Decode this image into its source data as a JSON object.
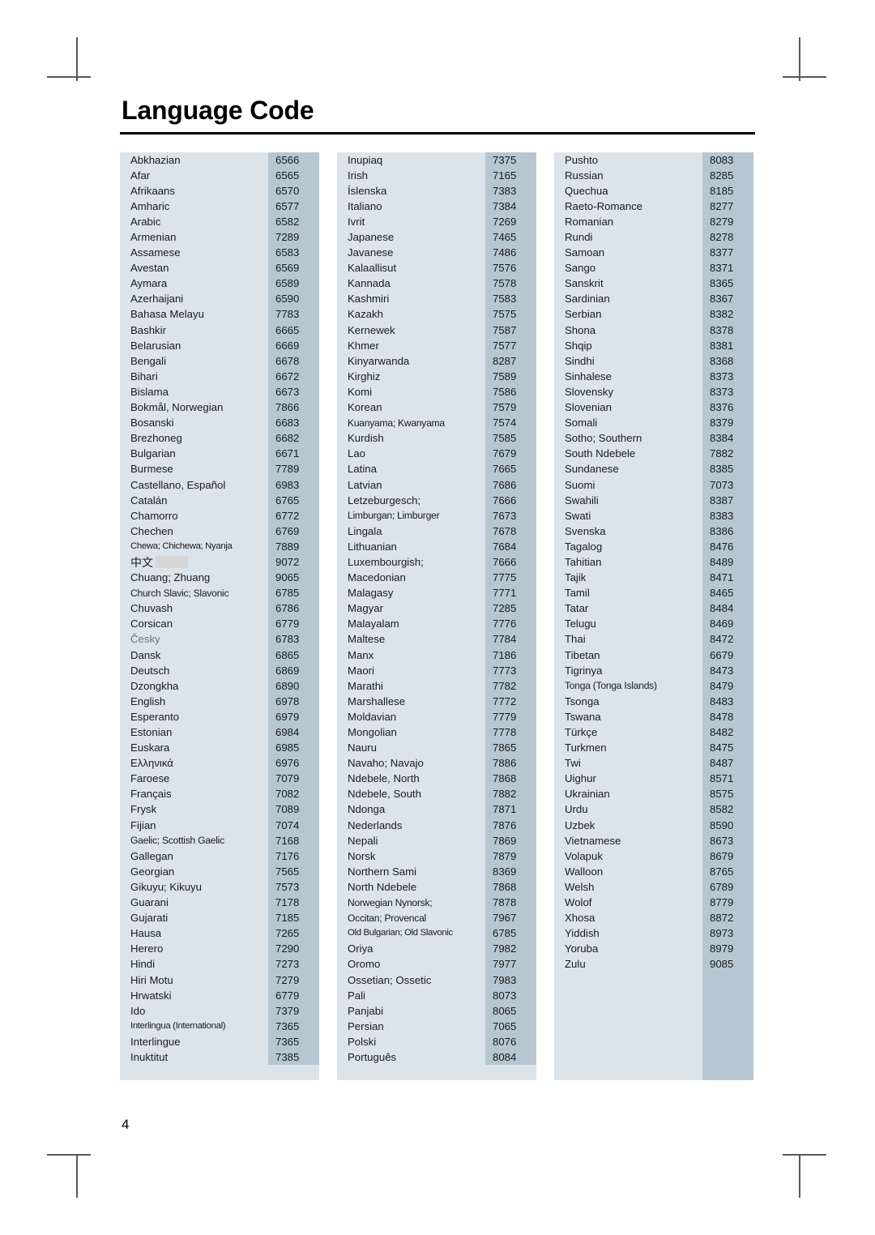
{
  "document": {
    "title": "Language Code",
    "page_number": "4"
  },
  "colors": {
    "name_band": "#dbe4ea",
    "code_band": "#b6c7d2",
    "rule": "#000000",
    "crop_mark": "#58595b",
    "redaction": "#d6d6d6"
  },
  "columns": [
    {
      "id": "column-1",
      "rows": [
        {
          "name": "Abkhazian",
          "code": "6566"
        },
        {
          "name": "Afar",
          "code": "6565"
        },
        {
          "name": "Afrikaans",
          "code": "6570"
        },
        {
          "name": "Amharic",
          "code": "6577"
        },
        {
          "name": "Arabic",
          "code": "6582"
        },
        {
          "name": "Armenian",
          "code": "7289"
        },
        {
          "name": "Assamese",
          "code": "6583"
        },
        {
          "name": "Avestan",
          "code": "6569"
        },
        {
          "name": "Aymara",
          "code": "6589"
        },
        {
          "name": "Azerhaijani",
          "code": "6590"
        },
        {
          "name": "Bahasa Melayu",
          "code": "7783"
        },
        {
          "name": "Bashkir",
          "code": "6665"
        },
        {
          "name": "Belarusian",
          "code": "6669"
        },
        {
          "name": "Bengali",
          "code": "6678"
        },
        {
          "name": "Bihari",
          "code": "6672"
        },
        {
          "name": "Bislama",
          "code": "6673"
        },
        {
          "name": "Bokmål, Norwegian",
          "code": "7866"
        },
        {
          "name": "Bosanski",
          "code": "6683"
        },
        {
          "name": "Brezhoneg",
          "code": "6682"
        },
        {
          "name": "Bulgarian",
          "code": "6671"
        },
        {
          "name": "Burmese",
          "code": "7789"
        },
        {
          "name": "Castellano, Español",
          "code": "6983"
        },
        {
          "name": "Catalán",
          "code": "6765"
        },
        {
          "name": "Chamorro",
          "code": "6772"
        },
        {
          "name": "Chechen",
          "code": "6769"
        },
        {
          "name": "Chewa; Chichewa; Nyanja",
          "code": "7889",
          "fit": "tighter"
        },
        {
          "name": "中文",
          "code": "9072",
          "style": "cjk-redacted"
        },
        {
          "name": "Chuang; Zhuang",
          "code": "9065"
        },
        {
          "name": "Church Slavic; Slavonic",
          "code": "6785",
          "fit": "tight"
        },
        {
          "name": "Chuvash",
          "code": "6786"
        },
        {
          "name": "Corsican",
          "code": "6779"
        },
        {
          "name": "Česky",
          "code": "6783",
          "style": "greyed"
        },
        {
          "name": "Dansk",
          "code": "6865"
        },
        {
          "name": "Deutsch",
          "code": "6869"
        },
        {
          "name": "Dzongkha",
          "code": "6890"
        },
        {
          "name": "English",
          "code": "6978"
        },
        {
          "name": "Esperanto",
          "code": "6979"
        },
        {
          "name": "Estonian",
          "code": "6984"
        },
        {
          "name": "Euskara",
          "code": "6985"
        },
        {
          "name": "Ελληνικά",
          "code": "6976"
        },
        {
          "name": "Faroese",
          "code": "7079"
        },
        {
          "name": "Français",
          "code": "7082"
        },
        {
          "name": "Frysk",
          "code": "7089"
        },
        {
          "name": "Fijian",
          "code": "7074"
        },
        {
          "name": "Gaelic; Scottish Gaelic",
          "code": "7168",
          "fit": "tight"
        },
        {
          "name": "Gallegan",
          "code": "7176"
        },
        {
          "name": "Georgian",
          "code": "7565"
        },
        {
          "name": "Gikuyu; Kikuyu",
          "code": "7573"
        },
        {
          "name": "Guarani",
          "code": "7178"
        },
        {
          "name": "Gujarati",
          "code": "7185"
        },
        {
          "name": "Hausa",
          "code": "7265"
        },
        {
          "name": "Herero",
          "code": "7290"
        },
        {
          "name": "Hindi",
          "code": "7273"
        },
        {
          "name": "Hiri Motu",
          "code": "7279"
        },
        {
          "name": "Hrwatski",
          "code": "6779"
        },
        {
          "name": "Ido",
          "code": "7379"
        },
        {
          "name": "Interlingua (International)",
          "code": "7365",
          "fit": "tighter"
        },
        {
          "name": "Interlingue",
          "code": "7365"
        },
        {
          "name": "Inuktitut",
          "code": "7385"
        }
      ]
    },
    {
      "id": "column-2",
      "rows": [
        {
          "name": "Inupiaq",
          "code": "7375"
        },
        {
          "name": "Irish",
          "code": "7165"
        },
        {
          "name": "Íslenska",
          "code": "7383"
        },
        {
          "name": "Italiano",
          "code": "7384"
        },
        {
          "name": "Ivrit",
          "code": "7269"
        },
        {
          "name": "Japanese",
          "code": "7465"
        },
        {
          "name": "Javanese",
          "code": "7486"
        },
        {
          "name": "Kalaallisut",
          "code": "7576"
        },
        {
          "name": "Kannada",
          "code": "7578"
        },
        {
          "name": "Kashmiri",
          "code": "7583"
        },
        {
          "name": "Kazakh",
          "code": "7575"
        },
        {
          "name": "Kernewek",
          "code": "7587"
        },
        {
          "name": "Khmer",
          "code": "7577"
        },
        {
          "name": "Kinyarwanda",
          "code": "8287"
        },
        {
          "name": "Kirghiz",
          "code": "7589"
        },
        {
          "name": "Komi",
          "code": "7586"
        },
        {
          "name": "Korean",
          "code": "7579"
        },
        {
          "name": "Kuanyama; Kwanyama",
          "code": "7574",
          "fit": "tight"
        },
        {
          "name": "Kurdish",
          "code": "7585"
        },
        {
          "name": "Lao",
          "code": "7679"
        },
        {
          "name": "Latina",
          "code": "7665"
        },
        {
          "name": "Latvian",
          "code": "7686"
        },
        {
          "name": "Letzeburgesch;",
          "code": "7666"
        },
        {
          "name": "Limburgan; Limburger",
          "code": "7673",
          "fit": "tight"
        },
        {
          "name": "Lingala",
          "code": "7678"
        },
        {
          "name": "Lithuanian",
          "code": "7684"
        },
        {
          "name": "Luxembourgish;",
          "code": "7666"
        },
        {
          "name": "Macedonian",
          "code": "7775"
        },
        {
          "name": "Malagasy",
          "code": "7771"
        },
        {
          "name": "Magyar",
          "code": "7285"
        },
        {
          "name": "Malayalam",
          "code": "7776"
        },
        {
          "name": "Maltese",
          "code": "7784"
        },
        {
          "name": "Manx",
          "code": "7186"
        },
        {
          "name": "Maori",
          "code": "7773"
        },
        {
          "name": "Marathi",
          "code": "7782"
        },
        {
          "name": "Marshallese",
          "code": "7772"
        },
        {
          "name": "Moldavian",
          "code": "7779"
        },
        {
          "name": "Mongolian",
          "code": "7778"
        },
        {
          "name": "Nauru",
          "code": "7865"
        },
        {
          "name": "Navaho; Navajo",
          "code": "7886"
        },
        {
          "name": "Ndebele, North",
          "code": "7868"
        },
        {
          "name": "Ndebele, South",
          "code": "7882"
        },
        {
          "name": "Ndonga",
          "code": "7871"
        },
        {
          "name": "Nederlands",
          "code": "7876"
        },
        {
          "name": "Nepali",
          "code": "7869"
        },
        {
          "name": "Norsk",
          "code": "7879"
        },
        {
          "name": "Northern Sami",
          "code": "8369"
        },
        {
          "name": "North Ndebele",
          "code": "7868"
        },
        {
          "name": "Norwegian Nynorsk;",
          "code": "7878",
          "fit": "tight"
        },
        {
          "name": "Occitan; Provencal",
          "code": "7967",
          "fit": "tight"
        },
        {
          "name": "Old Bulgarian; Old Slavonic",
          "code": "6785",
          "fit": "tighter"
        },
        {
          "name": "Oriya",
          "code": "7982"
        },
        {
          "name": "Oromo",
          "code": "7977"
        },
        {
          "name": "Ossetian; Ossetic",
          "code": "7983"
        },
        {
          "name": "Pali",
          "code": "8073"
        },
        {
          "name": "Panjabi",
          "code": "8065"
        },
        {
          "name": "Persian",
          "code": "7065"
        },
        {
          "name": "Polski",
          "code": "8076"
        },
        {
          "name": "Português",
          "code": "8084"
        }
      ]
    },
    {
      "id": "column-3",
      "rows": [
        {
          "name": "Pushto",
          "code": "8083"
        },
        {
          "name": "Russian",
          "code": "8285"
        },
        {
          "name": "Quechua",
          "code": "8185"
        },
        {
          "name": "Raeto-Romance",
          "code": "8277"
        },
        {
          "name": "Romanian",
          "code": "8279"
        },
        {
          "name": "Rundi",
          "code": "8278"
        },
        {
          "name": "Samoan",
          "code": "8377"
        },
        {
          "name": "Sango",
          "code": "8371"
        },
        {
          "name": "Sanskrit",
          "code": "8365"
        },
        {
          "name": "Sardinian",
          "code": "8367"
        },
        {
          "name": "Serbian",
          "code": "8382"
        },
        {
          "name": "Shona",
          "code": "8378"
        },
        {
          "name": "Shqip",
          "code": "8381"
        },
        {
          "name": "Sindhi",
          "code": "8368"
        },
        {
          "name": "Sinhalese",
          "code": "8373"
        },
        {
          "name": "Slovensky",
          "code": "8373"
        },
        {
          "name": "Slovenian",
          "code": "8376"
        },
        {
          "name": "Somali",
          "code": "8379"
        },
        {
          "name": "Sotho; Southern",
          "code": "8384"
        },
        {
          "name": "South Ndebele",
          "code": "7882"
        },
        {
          "name": "Sundanese",
          "code": "8385"
        },
        {
          "name": "Suomi",
          "code": "7073"
        },
        {
          "name": "Swahili",
          "code": "8387"
        },
        {
          "name": "Swati",
          "code": "8383"
        },
        {
          "name": "Svenska",
          "code": "8386"
        },
        {
          "name": "Tagalog",
          "code": "8476"
        },
        {
          "name": "Tahitian",
          "code": "8489"
        },
        {
          "name": "Tajik",
          "code": "8471"
        },
        {
          "name": "Tamil",
          "code": "8465"
        },
        {
          "name": "Tatar",
          "code": "8484"
        },
        {
          "name": "Telugu",
          "code": "8469"
        },
        {
          "name": "Thai",
          "code": "8472"
        },
        {
          "name": "Tibetan",
          "code": "6679"
        },
        {
          "name": "Tigrinya",
          "code": "8473"
        },
        {
          "name": "Tonga (Tonga Islands)",
          "code": "8479",
          "fit": "tight"
        },
        {
          "name": "Tsonga",
          "code": "8483"
        },
        {
          "name": "Tswana",
          "code": "8478"
        },
        {
          "name": "Türkçe",
          "code": "8482"
        },
        {
          "name": "Turkmen",
          "code": "8475"
        },
        {
          "name": "Twi",
          "code": "8487"
        },
        {
          "name": "Uighur",
          "code": "8571"
        },
        {
          "name": "Ukrainian",
          "code": "8575"
        },
        {
          "name": "Urdu",
          "code": "8582"
        },
        {
          "name": "Uzbek",
          "code": "8590"
        },
        {
          "name": "Vietnamese",
          "code": "8673"
        },
        {
          "name": "Volapuk",
          "code": "8679"
        },
        {
          "name": "Walloon",
          "code": "8765"
        },
        {
          "name": "Welsh",
          "code": "6789"
        },
        {
          "name": "Wolof",
          "code": "8779"
        },
        {
          "name": "Xhosa",
          "code": "8872"
        },
        {
          "name": "Yiddish",
          "code": "8973"
        },
        {
          "name": "Yoruba",
          "code": "8979"
        },
        {
          "name": "Zulu",
          "code": "9085"
        },
        {
          "name": "",
          "code": ""
        },
        {
          "name": "",
          "code": ""
        },
        {
          "name": "",
          "code": ""
        },
        {
          "name": "",
          "code": ""
        },
        {
          "name": "",
          "code": ""
        },
        {
          "name": "",
          "code": ""
        },
        {
          "name": "",
          "code": ""
        }
      ]
    }
  ]
}
